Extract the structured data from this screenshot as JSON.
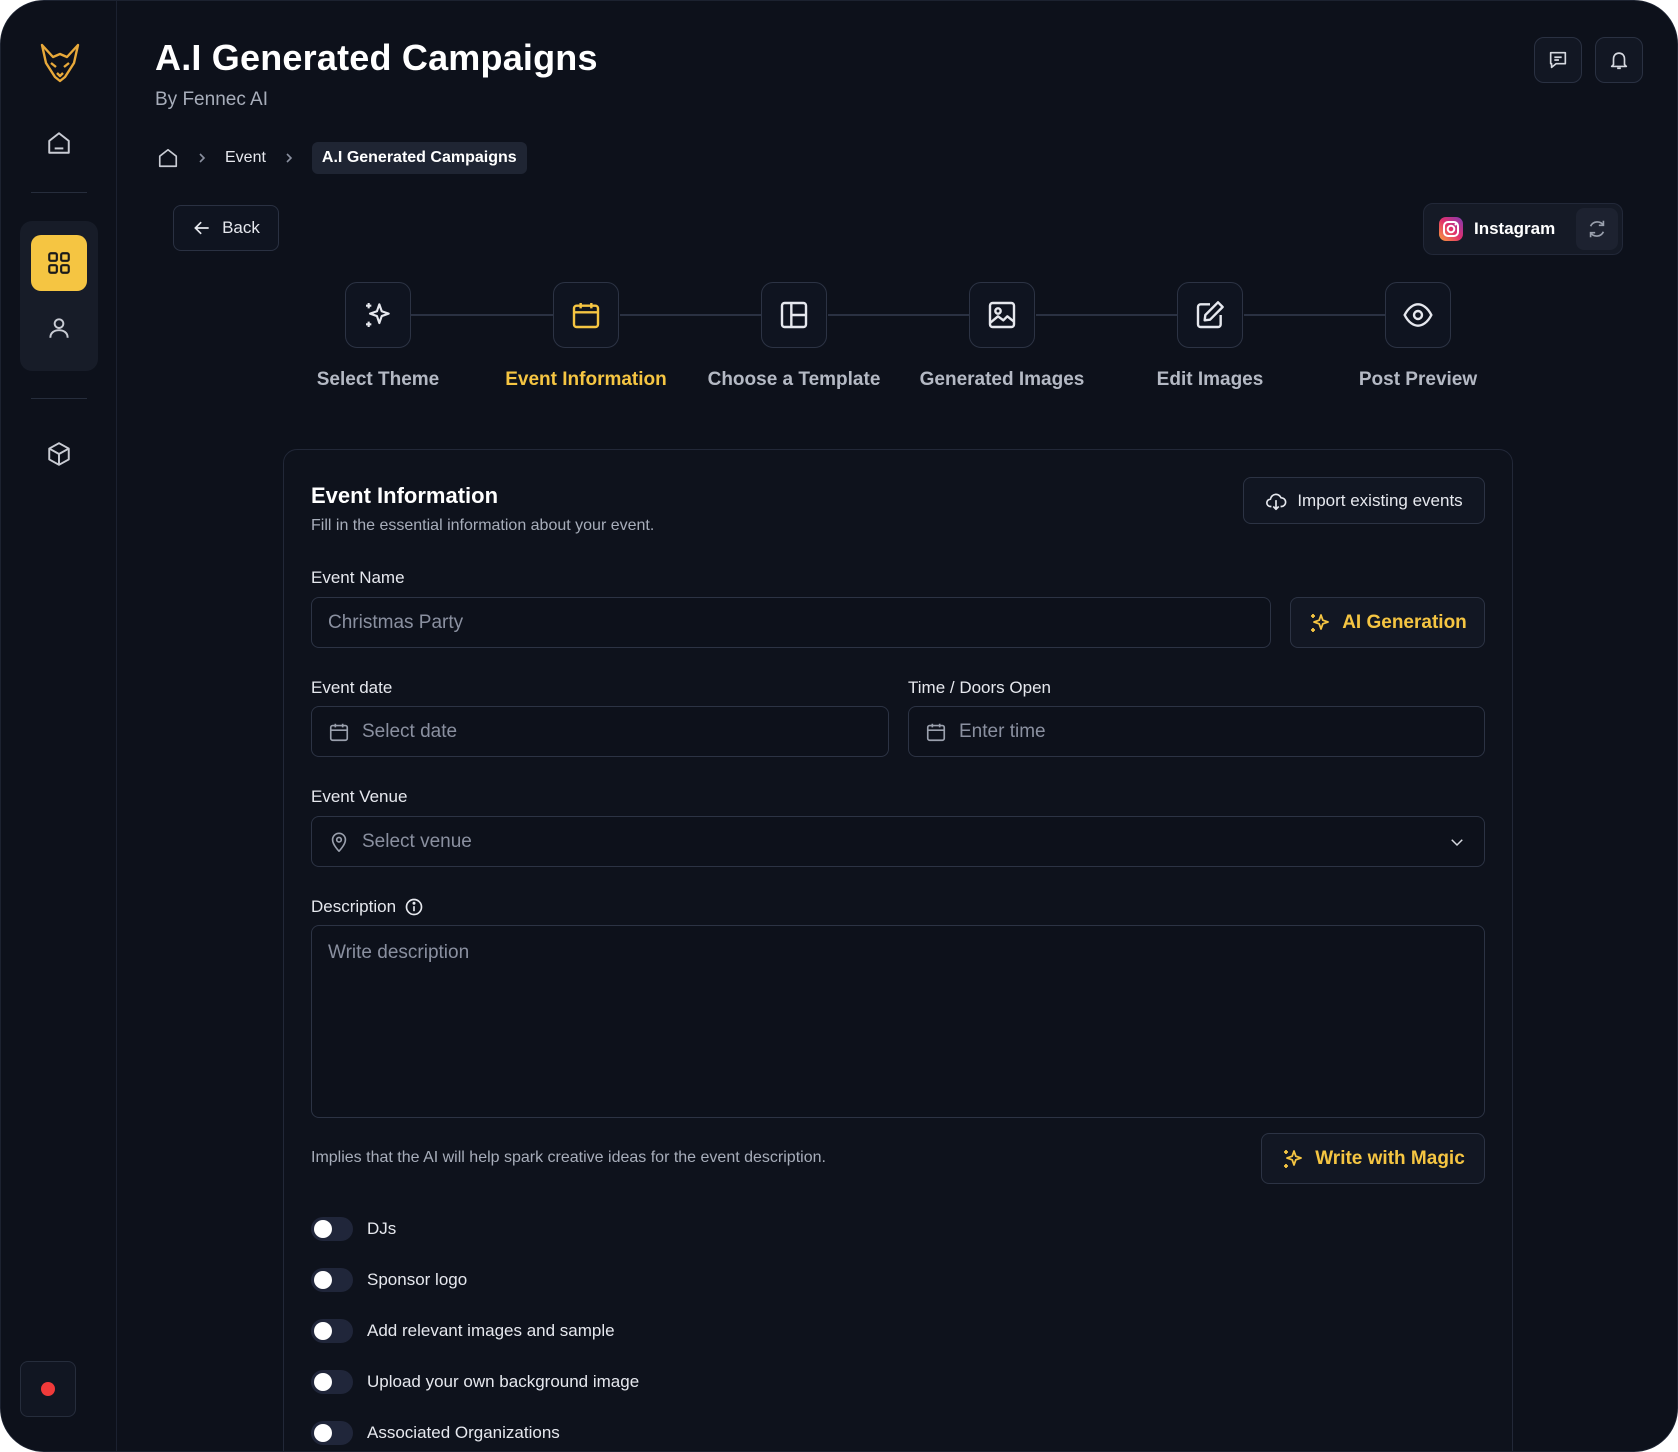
{
  "header": {
    "title": "A.I Generated Campaigns",
    "subtitle": "By Fennec AI",
    "chat_icon": "chat-icon",
    "bell_icon": "bell-icon"
  },
  "breadcrumb": {
    "home_icon": "home-icon",
    "items": [
      "Event",
      "A.I Generated Campaigns"
    ]
  },
  "back_label": "Back",
  "platform": {
    "label": "Instagram",
    "icon": "instagram-icon",
    "refresh_icon": "refresh-icon"
  },
  "steps": [
    {
      "label": "Select Theme",
      "icon": "sparkles-icon",
      "active": false
    },
    {
      "label": "Event Information",
      "icon": "calendar-icon",
      "active": true
    },
    {
      "label": "Choose a Template",
      "icon": "layout-icon",
      "active": false
    },
    {
      "label": "Generated Images",
      "icon": "image-icon",
      "active": false
    },
    {
      "label": "Edit Images",
      "icon": "edit-icon",
      "active": false
    },
    {
      "label": "Post Preview",
      "icon": "eye-icon",
      "active": false
    }
  ],
  "card": {
    "title": "Event Information",
    "subtitle": "Fill in the essential information about your event.",
    "import_label": "Import existing events"
  },
  "form": {
    "event_name": {
      "label": "Event Name",
      "placeholder": "Christmas Party"
    },
    "ai_generation_label": "AI Generation",
    "event_date": {
      "label": "Event date",
      "placeholder": "Select date"
    },
    "time": {
      "label": "Time / Doors Open",
      "placeholder": "Enter time"
    },
    "venue": {
      "label": "Event Venue",
      "placeholder": "Select venue"
    },
    "description": {
      "label": "Description",
      "placeholder": "Write description"
    },
    "hint": "Implies that the AI will help spark creative ideas for the event description.",
    "magic_label": "Write with Magic"
  },
  "toggles": [
    {
      "label": "DJs",
      "on": false
    },
    {
      "label": "Sponsor logo",
      "on": false
    },
    {
      "label": "Add relevant images and sample",
      "on": false
    },
    {
      "label": "Upload your own background image",
      "on": false
    },
    {
      "label": "Associated Organizations",
      "on": false
    }
  ],
  "colors": {
    "accent": "#f5c542",
    "background": "#0d111b",
    "record": "#f03a3a"
  }
}
